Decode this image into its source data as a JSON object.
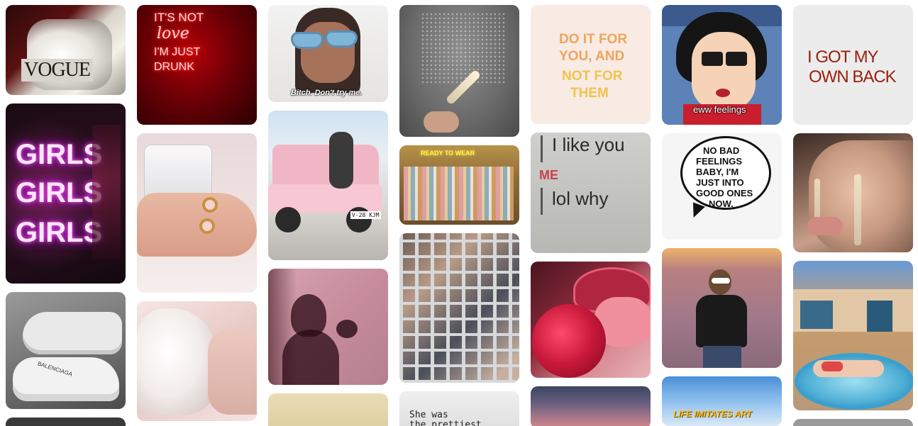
{
  "pins": {
    "vogue": {
      "text": "VOGUE"
    },
    "neon_love": {
      "line1": "IT'S NOT",
      "line2": "love",
      "line3": "I'M JUST",
      "line4": "DRUNK"
    },
    "sunglasses": {
      "caption": "Bitch. Don't try me."
    },
    "do_it": {
      "line1": "DO IT FOR",
      "line2": "YOU, AND",
      "line3": "NOT FOR",
      "line4": "THEM"
    },
    "daria": {
      "caption": "eww feelings"
    },
    "own_back": {
      "line1": "I GOT MY",
      "line2": "OWN BACK"
    },
    "girls": {
      "word": "GIRLS"
    },
    "ready_to_wear": {
      "sign": "READY TO WEAR"
    },
    "like_you": {
      "line1": "I like you",
      "label": "ME",
      "line2": "lol why"
    },
    "no_bad": {
      "line1": "NO BAD",
      "line2": "FEELINGS",
      "line3": "BABY, I'M",
      "line4": "JUST INTO",
      "line5": "GOOD ONES",
      "line6": "NOW."
    },
    "sneakers": {
      "brand": "BALENCIAGA"
    },
    "car": {
      "plate": "V-28 KJM"
    },
    "prettiest": {
      "line1": "She was",
      "line2": "the prettiest"
    },
    "life_imitates_art": {
      "text": "LIFE IMITATES ART"
    }
  },
  "colors": {
    "neon_red": "#ff2020",
    "daria_red": "#c81e2e",
    "page_bg": "#ffffff"
  }
}
